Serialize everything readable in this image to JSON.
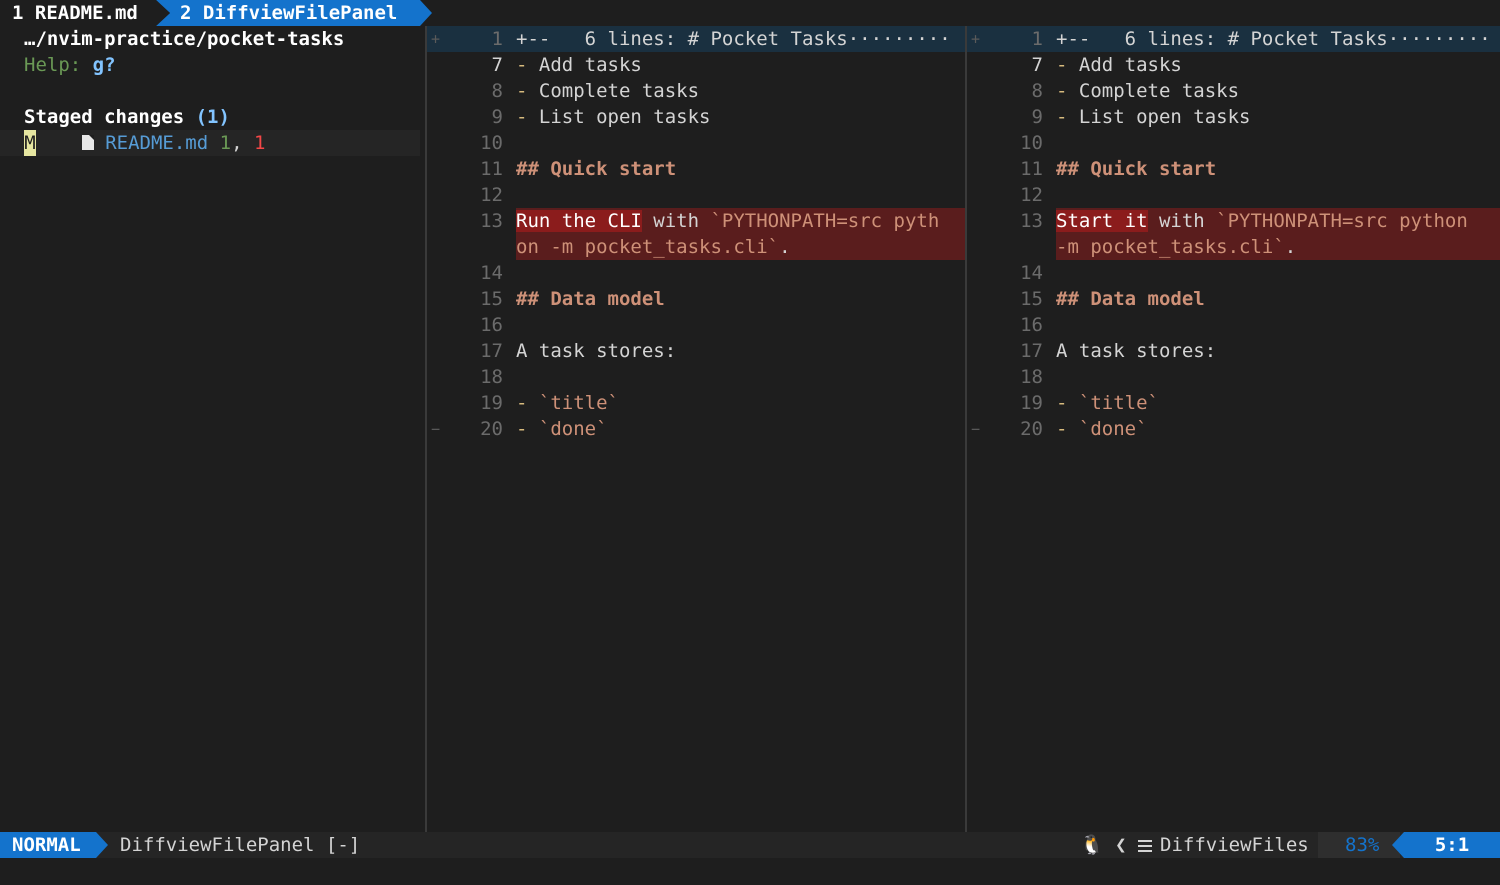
{
  "tabline": {
    "tab1": "1 README.md",
    "tab2": "2 DiffviewFilePanel"
  },
  "file_panel": {
    "path": "…/nvim-practice/pocket-tasks",
    "help_label": "Help:",
    "help_key": "g?",
    "staged_label": "Staged changes",
    "staged_count": "(1)",
    "entry": {
      "status": "M",
      "icon": "file-icon",
      "name": "README.md",
      "additions": "1",
      "sep": ",",
      "deletions": "1"
    }
  },
  "diff_left": {
    "lines": [
      {
        "sign": "+",
        "nr": "1",
        "text": "+--   6 lines: # Pocket Tasks·········",
        "kind": "fold"
      },
      {
        "sign": "",
        "nr": "7",
        "text": "- Add tasks",
        "kind": "list",
        "cur": true
      },
      {
        "sign": "",
        "nr": "8",
        "text": "- Complete tasks",
        "kind": "list"
      },
      {
        "sign": "",
        "nr": "9",
        "text": "- List open tasks",
        "kind": "list"
      },
      {
        "sign": "",
        "nr": "10",
        "text": "",
        "kind": "plain"
      },
      {
        "sign": "",
        "nr": "11",
        "text": "## Quick start",
        "kind": "header"
      },
      {
        "sign": "",
        "nr": "12",
        "text": "",
        "kind": "plain"
      },
      {
        "sign": "",
        "nr": "13",
        "changed": "Run the CLI",
        "rest": " with `PYTHONPATH=src pyth",
        "kind": "change"
      },
      {
        "sign": "",
        "nr": "",
        "text": "on -m pocket_tasks.cli`.",
        "kind": "change-cont"
      },
      {
        "sign": "",
        "nr": "14",
        "text": "",
        "kind": "plain"
      },
      {
        "sign": "",
        "nr": "15",
        "text": "## Data model",
        "kind": "header"
      },
      {
        "sign": "",
        "nr": "16",
        "text": "",
        "kind": "plain"
      },
      {
        "sign": "",
        "nr": "17",
        "text": "A task stores:",
        "kind": "plain"
      },
      {
        "sign": "",
        "nr": "18",
        "text": "",
        "kind": "plain"
      },
      {
        "sign": "",
        "nr": "19",
        "code": "`title`",
        "kind": "code-item"
      },
      {
        "sign": "−",
        "nr": "20",
        "code": "`done`",
        "kind": "code-item"
      }
    ]
  },
  "diff_right": {
    "lines": [
      {
        "sign": "+",
        "nr": "1",
        "text": "+--   6 lines: # Pocket Tasks·········",
        "kind": "fold"
      },
      {
        "sign": "",
        "nr": "7",
        "text": "- Add tasks",
        "kind": "list",
        "cur": true
      },
      {
        "sign": "",
        "nr": "8",
        "text": "- Complete tasks",
        "kind": "list"
      },
      {
        "sign": "",
        "nr": "9",
        "text": "- List open tasks",
        "kind": "list"
      },
      {
        "sign": "",
        "nr": "10",
        "text": "",
        "kind": "plain"
      },
      {
        "sign": "",
        "nr": "11",
        "text": "## Quick start",
        "kind": "header"
      },
      {
        "sign": "",
        "nr": "12",
        "text": "",
        "kind": "plain"
      },
      {
        "sign": "",
        "nr": "13",
        "changed": "Start it",
        "rest": " with `PYTHONPATH=src python",
        "kind": "change"
      },
      {
        "sign": "",
        "nr": "",
        "text": "-m pocket_tasks.cli`.",
        "kind": "change-cont"
      },
      {
        "sign": "",
        "nr": "14",
        "text": "",
        "kind": "plain"
      },
      {
        "sign": "",
        "nr": "15",
        "text": "## Data model",
        "kind": "header"
      },
      {
        "sign": "",
        "nr": "16",
        "text": "",
        "kind": "plain"
      },
      {
        "sign": "",
        "nr": "17",
        "text": "A task stores:",
        "kind": "plain"
      },
      {
        "sign": "",
        "nr": "18",
        "text": "",
        "kind": "plain"
      },
      {
        "sign": "",
        "nr": "19",
        "code": "`title`",
        "kind": "code-item"
      },
      {
        "sign": "−",
        "nr": "20",
        "code": "`done`",
        "kind": "code-item"
      }
    ]
  },
  "statusline": {
    "mode": "NORMAL",
    "filename": "DiffviewFilePanel [-]",
    "os_icon": "linux-icon",
    "filetype": "DiffviewFiles",
    "percent": "83%",
    "position": "5:1"
  },
  "colors": {
    "accent": "#1473cc",
    "change_line": "#5a1d1d",
    "change_text": "#8b1c1c",
    "fold": "#1a3040"
  }
}
